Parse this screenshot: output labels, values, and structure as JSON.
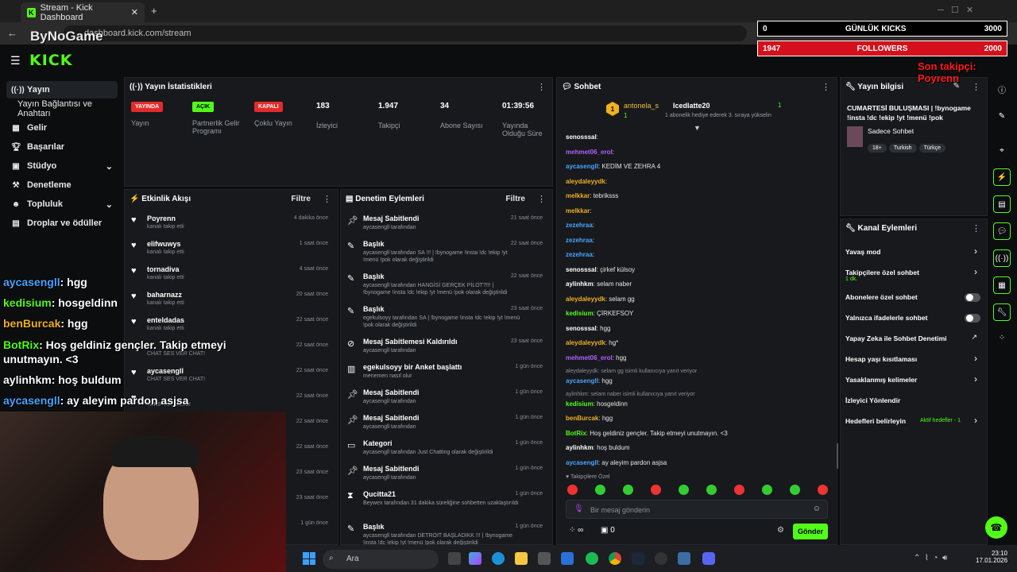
{
  "browser": {
    "tab_title": "Stream - Kick Dashboard",
    "url": "dashboard.kick.com/stream"
  },
  "watermark": "ByNoGame",
  "logo": "KICK",
  "sidebar": {
    "items": [
      {
        "label": "Yayın",
        "icon": "live-icon"
      },
      {
        "label": "Yayın Bağlantısı ve Anahtarı",
        "icon": ""
      },
      {
        "label": "Gelir",
        "icon": "revenue-icon"
      },
      {
        "label": "Başarılar",
        "icon": "trophy-icon"
      },
      {
        "label": "Stüdyo",
        "icon": "studio-icon"
      },
      {
        "label": "Denetleme",
        "icon": "hammer-icon"
      },
      {
        "label": "Topluluk",
        "icon": "community-icon"
      },
      {
        "label": "Droplar ve ödüller",
        "icon": "drops-icon"
      }
    ]
  },
  "stats": {
    "title": "Yayın İstatistikleri",
    "badges": [
      {
        "badge": "YAYINDA",
        "label": "Yayın",
        "color": "#e32b2b"
      },
      {
        "badge": "AÇIK",
        "label": "Partnerlik Gelir Programı",
        "color": "#53fc18"
      },
      {
        "badge": "KAPALI",
        "label": "Çoklu Yayın",
        "color": "#e32b2b"
      }
    ],
    "values": [
      {
        "value": "183",
        "label": "İzleyici"
      },
      {
        "value": "1.947",
        "label": "Takipçi"
      },
      {
        "value": "34",
        "label": "Abone Sayısı"
      },
      {
        "value": "01:39:56",
        "label": "Yayında Olduğu Süre"
      }
    ]
  },
  "activity": {
    "title": "Etkinlik Akışı",
    "filter": "Filtre",
    "rows": [
      {
        "name": "Poyrenn",
        "sub": "kanalı takip etti",
        "time": "4 dakika önce"
      },
      {
        "name": "elifwuwys",
        "sub": "kanalı takip etti",
        "time": "1 saat önce"
      },
      {
        "name": "tornadiva",
        "sub": "kanalı takip etti",
        "time": "4 saat önce"
      },
      {
        "name": "baharnazz",
        "sub": "kanalı takip etti",
        "time": "20 saat önce"
      },
      {
        "name": "enteldadas",
        "sub": "kanalı takip etti",
        "time": "22 saat önce"
      },
      {
        "name": "",
        "sub": "CHAT SES VER CHAT!",
        "time": "22 saat önce"
      },
      {
        "name": "aycasengll",
        "sub": "CHAT SES VER CHAT!",
        "time": "22 saat önce"
      },
      {
        "name": "",
        "sub": "TAKİP HATIRLICI",
        "time": "22 saat önce"
      },
      {
        "name": "",
        "sub": "",
        "time": "22 saat önce"
      },
      {
        "name": "",
        "sub": "",
        "time": "22 saat önce"
      },
      {
        "name": "",
        "sub": "",
        "time": "23 saat önce"
      },
      {
        "name": "",
        "sub": "",
        "time": "23 saat önce"
      },
      {
        "name": "",
        "sub": "",
        "time": "1 gün önce"
      }
    ]
  },
  "moderation": {
    "title": "Denetim Eylemleri",
    "filter": "Filtre",
    "rows": [
      {
        "title": "Mesaj Sabitlendi",
        "sub": "aycasengll tarafından",
        "time": "21 saat önce",
        "icon": "pin-icon"
      },
      {
        "title": "Başlık",
        "sub": "aycasengll tarafından SA !!! | !bynogame !insta !dc !ekip !yt !menü !pok olarak değiştirildi",
        "time": "22 saat önce",
        "icon": "user-edit-icon"
      },
      {
        "title": "Başlık",
        "sub": "aycasengll tarafından HANGİSİ GERÇEK PİLOT?!!! | !bynogame !insta !dc !ekip !yt !menü !pok olarak değiştirildi",
        "time": "22 saat önce",
        "icon": "user-edit-icon"
      },
      {
        "title": "Başlık",
        "sub": "egekulsoyy tarafından SA | !bynogame !insta !dc !ekip !yt !menü !pok olarak değiştirildi",
        "time": "23 saat önce",
        "icon": "user-edit-icon"
      },
      {
        "title": "Mesaj Sabitlemesi Kaldırıldı",
        "sub": "aycasengll tarafından",
        "time": "23 saat önce",
        "icon": "unpin-icon"
      },
      {
        "title": "egekulsoyy bir Anket başlattı",
        "sub": "menemen nasıl olur",
        "time": "1 gün önce",
        "icon": "poll-icon"
      },
      {
        "title": "Mesaj Sabitlendi",
        "sub": "aycasengll tarafından",
        "time": "1 gün önce",
        "icon": "pin-icon"
      },
      {
        "title": "Mesaj Sabitlendi",
        "sub": "aycasengll tarafından",
        "time": "1 gün önce",
        "icon": "pin-icon"
      },
      {
        "title": "Kategori",
        "sub": "aycasengll tarafından Just Chatting olarak değiştirildi",
        "time": "1 gün önce",
        "icon": "category-icon"
      },
      {
        "title": "Mesaj Sabitlendi",
        "sub": "aycasengll tarafından",
        "time": "1 gün önce",
        "icon": "pin-icon"
      },
      {
        "title": "Qucitta21",
        "sub": "Beywex tarafından 31 dakika süreliğine sohbetten uzaklaştırıldı",
        "time": "1 gün önce",
        "icon": "timeout-icon"
      },
      {
        "title": "Başlık",
        "sub": "aycasengll tarafından DETROIT BAŞLADIKK !!! | !bynogame !insta !dc !ekip !yt !menü !pok olarak değiştirildi",
        "time": "1 gün önce",
        "icon": "user-edit-icon"
      }
    ]
  },
  "chat": {
    "title": "Sohbet",
    "top_gifter1": "antonela_s",
    "top_gifter1_count": "1",
    "top_gifter2": "Icedlatte20",
    "top_gifter2_count": "1",
    "gift_note": "1 abonelik hediye ederek 3. sıraya yükselin",
    "messages": [
      {
        "user": "senosssal",
        "text": ""
      },
      {
        "user": "mehmet06_erol",
        "text": ""
      },
      {
        "user": "aycasengll",
        "text": "KEDİM VE ZEHRA 4"
      },
      {
        "user": "aleydaleyydk",
        "text": ""
      },
      {
        "user": "melkkar",
        "text": "tebriksss"
      },
      {
        "user": "melkkar",
        "text": ""
      },
      {
        "user": "zezehraa",
        "text": ""
      },
      {
        "user": "zezehraa",
        "text": ""
      },
      {
        "user": "zezehraa",
        "text": ""
      },
      {
        "user": "senosssal",
        "text": "çirkef külsoy"
      },
      {
        "user": "aylinhkm",
        "text": "selam naber"
      },
      {
        "user": "aleydaleyydk",
        "text": "selam gg"
      },
      {
        "user": "kedisium",
        "text": "ÇİRKEFSOY"
      },
      {
        "user": "senosssal",
        "text": "hgg"
      },
      {
        "user": "aleydaleyydk",
        "text": "hg*"
      },
      {
        "user": "mehmet06_erol",
        "text": "hgg"
      },
      {
        "reply": "aleydaleyydk: selam gg isimli kullanıcıya yanıt veriyor",
        "user": "aycasengll",
        "text": "hgg"
      },
      {
        "reply": "aylinhkm: selam naber isimli kullanıcıya yanıt veriyor",
        "user": "kedisium",
        "text": "hosgeldinn"
      },
      {
        "user": "benBurcak",
        "text": "hgg"
      },
      {
        "user": "BotRix",
        "text": "Hoş geldiniz gençler. Takip etmeyi unutmayın. <3"
      },
      {
        "user": "aylinhkm",
        "text": "hoş buldum"
      },
      {
        "user": "aycasengll",
        "text": "ay aleyim pardon asjsa"
      }
    ],
    "emote_label": "Takipçilere Özel",
    "input_placeholder": "Bir mesaj gönderin",
    "points": "∞",
    "gifts": "0",
    "send": "Gönder"
  },
  "info": {
    "title": "Yayın bilgisi",
    "stream_title": "CUMARTESİ BULUŞMASI | !bynogame !insta !dc !ekip !yt !menü !pok",
    "category": "Sadece Sohbet",
    "tags": [
      "18+",
      "Turkish",
      "Türkçe"
    ]
  },
  "channel": {
    "title": "Kanal Eylemleri",
    "items": [
      {
        "label": "Yavaş mod",
        "type": "arrow"
      },
      {
        "label": "Takipçilere özel sohbet",
        "sub": "1 dk.",
        "type": "arrow"
      },
      {
        "label": "Abonelere özel sohbet",
        "type": "toggle"
      },
      {
        "label": "Yalnızca ifadelerle sohbet",
        "type": "toggle"
      },
      {
        "label": "Yapay Zeka ile Sohbet Denetimi",
        "type": "external"
      },
      {
        "label": "Hesap yaşı kısıtlaması",
        "type": "arrow"
      },
      {
        "label": "Yasaklanmış kelimeler",
        "type": "arrow"
      },
      {
        "label": "İzleyici Yönlendir",
        "type": "none"
      },
      {
        "label": "Hedefleri belirleyin",
        "sub": "Aktif hedefler - 1",
        "type": "arrow"
      }
    ]
  },
  "overlay": {
    "kicks_label": "GÜNLÜK KICKS",
    "kicks_value": "0",
    "kicks_goal": "3000",
    "followers_label": "FOLLOWERS",
    "followers_value": "1947",
    "followers_goal": "2000",
    "last_follower": "Son takipçi: Poyrenn",
    "chat": [
      {
        "user": "aycasengll",
        "text": ": hgg"
      },
      {
        "user": "kedisium",
        "text": ": hosgeldinn"
      },
      {
        "user": "benBurcak",
        "text": ": hgg"
      },
      {
        "user": "BotRix",
        "text": ": Hoş geldiniz gençler. Takip etmeyi unutmayın. <3"
      },
      {
        "user": "aylinhkm",
        "text": ": hoş buldum"
      },
      {
        "user": "aycasengll",
        "text": ": ay aleyim pardon asjsa"
      }
    ]
  },
  "taskbar": {
    "search": "Ara",
    "time": "23:10",
    "date": "17.01.2026"
  }
}
